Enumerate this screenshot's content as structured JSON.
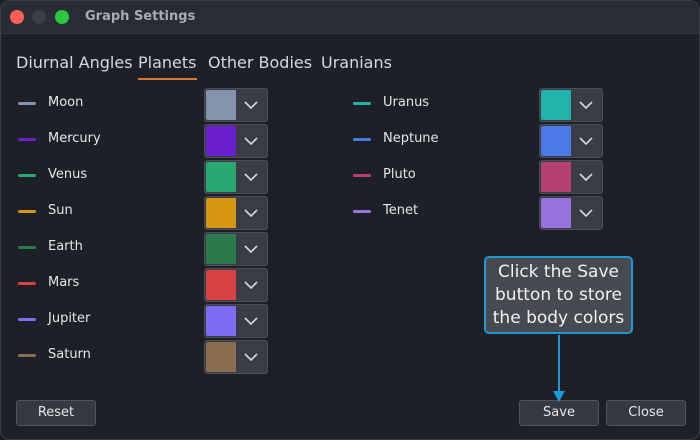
{
  "window": {
    "title": "Graph Settings"
  },
  "tabs": [
    {
      "label": "Diurnal Angles"
    },
    {
      "label": "Planets"
    },
    {
      "label": "Other Bodies"
    },
    {
      "label": "Uranians"
    }
  ],
  "left_bodies": [
    {
      "name": "Moon",
      "color": "#8494ad"
    },
    {
      "name": "Mercury",
      "color": "#6b1fcf"
    },
    {
      "name": "Venus",
      "color": "#2aa871"
    },
    {
      "name": "Sun",
      "color": "#d59610"
    },
    {
      "name": "Earth",
      "color": "#2a7a4c"
    },
    {
      "name": "Mars",
      "color": "#d94240"
    },
    {
      "name": "Jupiter",
      "color": "#7f6cf4"
    },
    {
      "name": "Saturn",
      "color": "#8b6d4d"
    }
  ],
  "right_bodies": [
    {
      "name": "Uranus",
      "color": "#1fb3ab"
    },
    {
      "name": "Neptune",
      "color": "#4b79e8"
    },
    {
      "name": "Pluto",
      "color": "#b54074"
    },
    {
      "name": "Tenet",
      "color": "#9873e0"
    }
  ],
  "buttons": {
    "reset": "Reset",
    "save": "Save",
    "close": "Close"
  },
  "callout": {
    "line1": "Click the Save",
    "line2": "button to store",
    "line3": "the body colors"
  },
  "accent": {
    "tab_underline": "#e0772d",
    "callout_border": "#1b9ad6"
  }
}
